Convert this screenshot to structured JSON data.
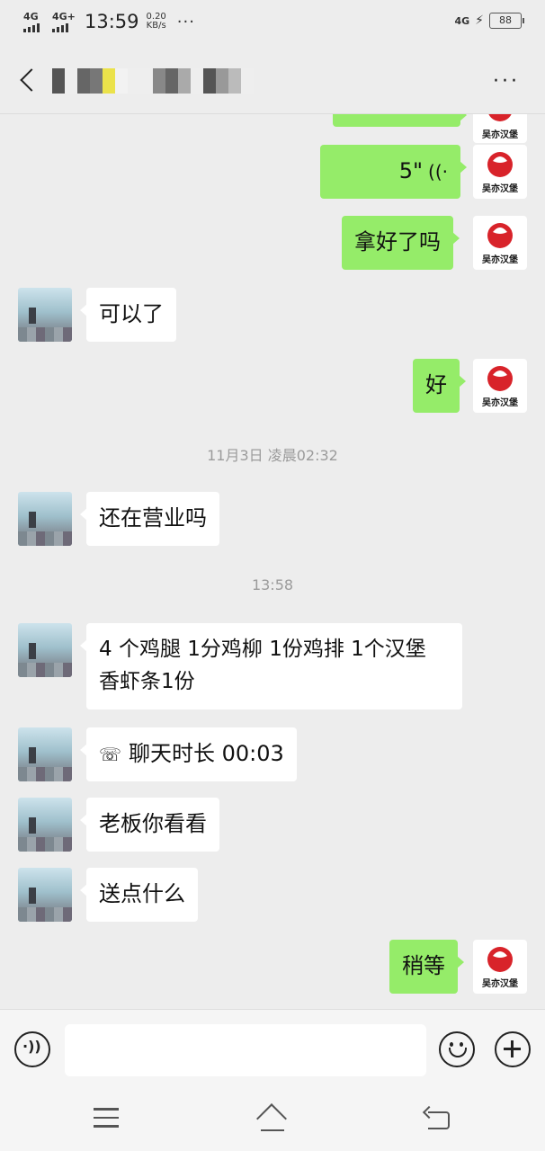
{
  "status_bar": {
    "signal_1": "4G",
    "signal_2": "4G+",
    "time": "13:59",
    "speed_value": "0.20",
    "speed_unit": "KB/s",
    "overflow": "···",
    "network_right": "4G",
    "battery": "88"
  },
  "header": {
    "more_label": "···"
  },
  "messages": [
    {
      "side": "me",
      "type": "voice",
      "text": "5\""
    },
    {
      "side": "me",
      "type": "text",
      "text": "拿好了吗"
    },
    {
      "side": "peer",
      "type": "text",
      "text": "可以了"
    },
    {
      "side": "me",
      "type": "text",
      "text": "好"
    },
    {
      "type": "time",
      "text": "11月3日 凌晨02:32"
    },
    {
      "side": "peer",
      "type": "text",
      "text": "还在营业吗"
    },
    {
      "type": "time",
      "text": "13:58"
    },
    {
      "side": "peer",
      "type": "text",
      "text": "4 个鸡腿 1分鸡柳 1份鸡排  1个汉堡    香虾条1份"
    },
    {
      "side": "peer",
      "type": "call",
      "text": "聊天时长 00:03"
    },
    {
      "side": "peer",
      "type": "text",
      "text": "老板你看看"
    },
    {
      "side": "peer",
      "type": "text",
      "text": "送点什么"
    },
    {
      "side": "me",
      "type": "text",
      "text": "稍等"
    }
  ],
  "avatar_me": {
    "logo_text": "吴亦汉堡",
    "brand_color": "#d8232a"
  },
  "colors": {
    "my_bubble": "#95ec69",
    "peer_bubble": "#ffffff",
    "background": "#ededed"
  }
}
